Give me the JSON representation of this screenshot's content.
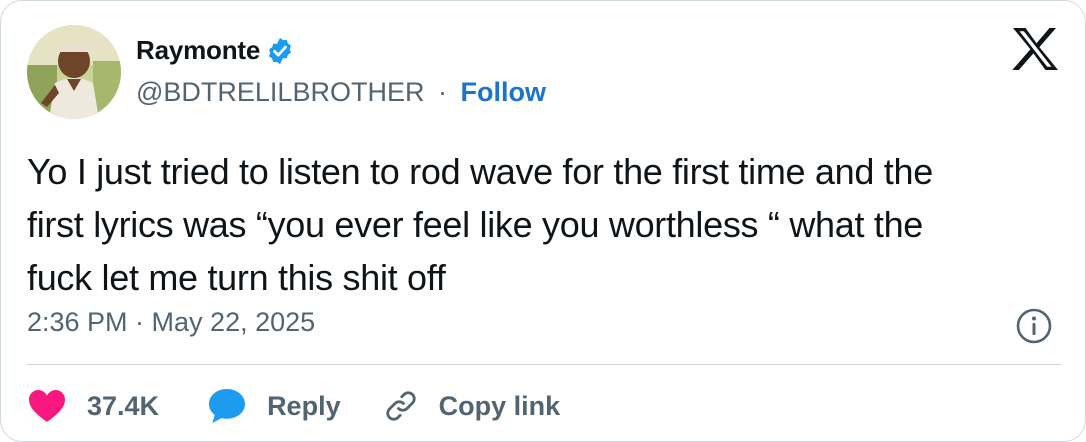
{
  "author": {
    "display_name": "Raymonte",
    "handle": "@BDTRELILBROTHER",
    "separator": "·",
    "follow_label": "Follow",
    "verified": true
  },
  "tweet": {
    "text": "Yo I just tried to listen to rod wave for the first time and the\nfirst lyrics was “you ever feel like you worthless “ what the\nfuck let me turn this shit off",
    "timestamp": "2:36 PM · May 22, 2025"
  },
  "actions": {
    "like_count": "37.4K",
    "reply_label": "Reply",
    "copy_link_label": "Copy link"
  },
  "colors": {
    "like": "#f91880",
    "reply": "#1d9bf0",
    "follow": "#1d75c9",
    "verified": "#1d9bf0",
    "muted_text": "#536471"
  },
  "icons": [
    "verified-badge-icon",
    "x-logo-icon",
    "info-icon",
    "heart-icon",
    "reply-bubble-icon",
    "link-icon"
  ]
}
